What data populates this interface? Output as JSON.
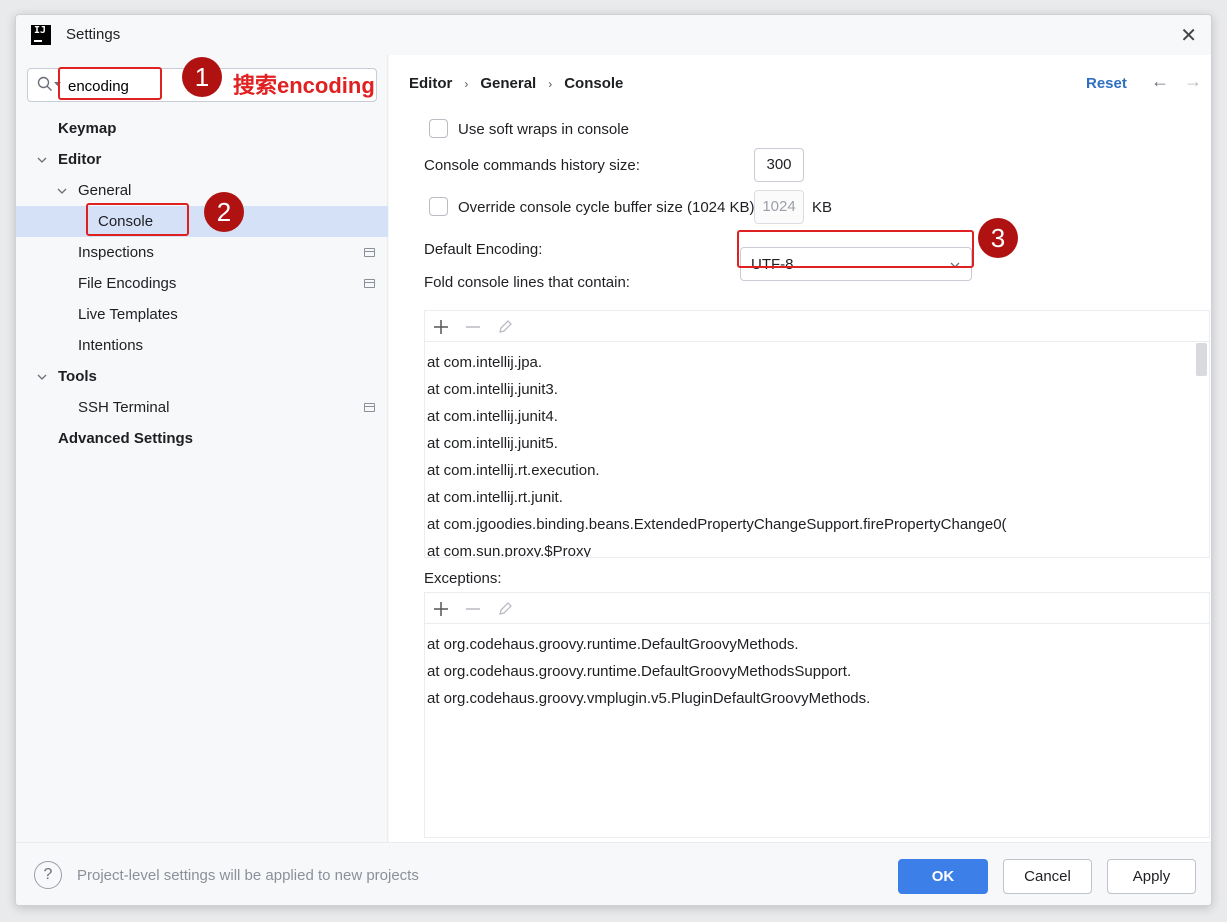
{
  "window": {
    "title": "Settings"
  },
  "search": {
    "value": "encoding"
  },
  "tree": {
    "keymap": "Keymap",
    "editor": "Editor",
    "general": "General",
    "console": "Console",
    "inspections": "Inspections",
    "file_encodings": "File Encodings",
    "live_templates": "Live Templates",
    "intentions": "Intentions",
    "tools": "Tools",
    "ssh_terminal": "SSH Terminal",
    "advanced": "Advanced Settings"
  },
  "breadcrumb": [
    "Editor",
    "General",
    "Console"
  ],
  "header": {
    "reset": "Reset",
    "back_icon": "←",
    "forward_icon": "→"
  },
  "settings": {
    "soft_wraps": "Use soft wraps in console",
    "history_label": "Console commands history size:",
    "history_value": "300",
    "override_label": "Override console cycle buffer size (1024 KB)",
    "buffer_value": "1024",
    "buffer_unit": "KB",
    "encoding_label": "Default Encoding:",
    "encoding_value": "UTF-8",
    "fold_label": "Fold console lines that contain:",
    "exceptions_label": "Exceptions:"
  },
  "fold_lines": [
    "at com.intellij.jpa.",
    "at com.intellij.junit3.",
    "at com.intellij.junit4.",
    "at com.intellij.junit5.",
    "at com.intellij.rt.execution.",
    "at com.intellij.rt.junit.",
    "at com.jgoodies.binding.beans.ExtendedPropertyChangeSupport.firePropertyChange0(",
    "at com.sun.proxy.$Proxy"
  ],
  "exceptions": [
    "at org.codehaus.groovy.runtime.DefaultGroovyMethods.",
    "at org.codehaus.groovy.runtime.DefaultGroovyMethodsSupport.",
    "at org.codehaus.groovy.vmplugin.v5.PluginDefaultGroovyMethods."
  ],
  "footer": {
    "help": "?",
    "text": "Project-level settings will be applied to new projects",
    "ok": "OK",
    "cancel": "Cancel",
    "apply": "Apply"
  },
  "annotations": {
    "step1": "1",
    "step1_text": "搜索encoding",
    "step2": "2",
    "step3": "3"
  },
  "colors": {
    "accent": "#3d7fe8",
    "selection": "#d5e1f7",
    "annotation": "#e02121",
    "badge": "#b01212"
  }
}
